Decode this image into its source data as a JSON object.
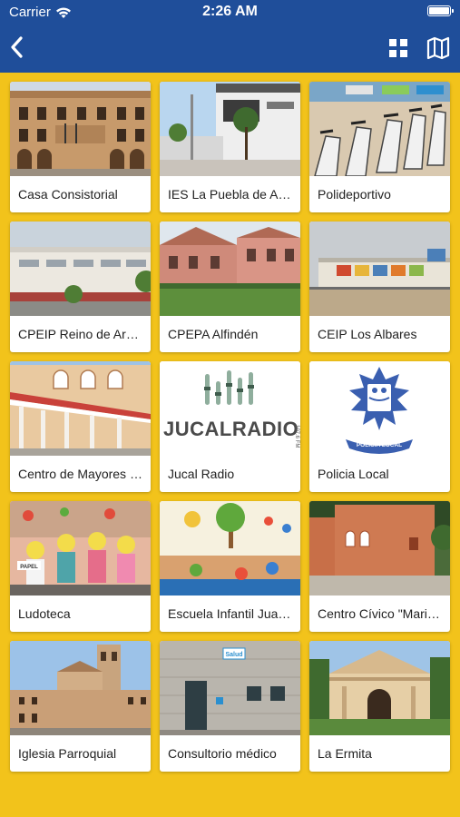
{
  "status_bar": {
    "carrier": "Carrier",
    "time": "2:26 AM"
  },
  "nav": {
    "back_icon": "chevron-left-icon",
    "grid_icon": "grid-icon",
    "map_icon": "map-icon"
  },
  "colors": {
    "brand_blue": "#1F4E9A",
    "background_yellow": "#F2C31B",
    "card_bg": "#FFFFFF"
  },
  "items": [
    {
      "label": "Casa Consistorial"
    },
    {
      "label": "IES La Puebla de Alfindén"
    },
    {
      "label": "Polideportivo"
    },
    {
      "label": "CPEIP Reino de Aragón"
    },
    {
      "label": "CPEPA Alfindén"
    },
    {
      "label": "CEIP Los Albares"
    },
    {
      "label": "Centro de Mayores San José"
    },
    {
      "label": "Jucal Radio"
    },
    {
      "label": "Policia Local"
    },
    {
      "label": "Ludoteca"
    },
    {
      "label": "Escuela Infantil Juan XXIII"
    },
    {
      "label": "Centro Cívico \"Mariano...\""
    },
    {
      "label": "Iglesia Parroquial"
    },
    {
      "label": "Consultorio médico"
    },
    {
      "label": "La Ermita"
    }
  ],
  "thumbs": {
    "radio_text": "JUCALRADIO",
    "radio_freq": "107.6 FM",
    "police_text": "POLICIA LOCAL",
    "ludoteca_sign": "PAPEL",
    "consultorio_sign": "Salud"
  }
}
